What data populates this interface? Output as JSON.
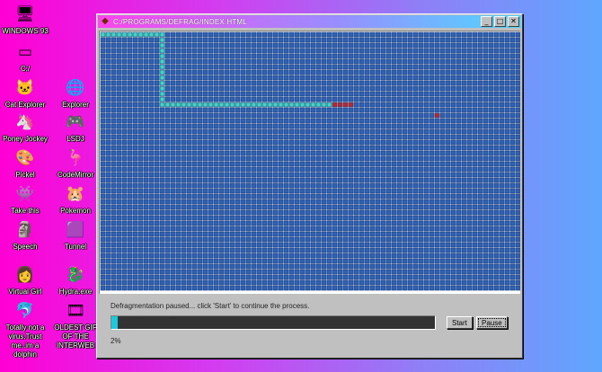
{
  "desktop": {
    "icons": [
      {
        "label": "WINDOWS 93",
        "glyph": "🖥"
      },
      {
        "label": "C:/",
        "glyph": "▭"
      },
      {
        "label": "Cat Explorer",
        "glyph": "🐱"
      },
      {
        "label": "Explorer",
        "glyph": "🌐"
      },
      {
        "label": "Poney Jockey",
        "glyph": "🦄"
      },
      {
        "label": "LSDJ",
        "glyph": "🎮"
      },
      {
        "label": "Pickel",
        "glyph": "🎨"
      },
      {
        "label": "CodeMirror",
        "glyph": "🦩"
      },
      {
        "label": "Take this",
        "glyph": "👾"
      },
      {
        "label": "Pokemon",
        "glyph": "🐹"
      },
      {
        "label": "Speech",
        "glyph": "🗿"
      },
      {
        "label": "Tunnel",
        "glyph": "🟪"
      },
      {
        "label": "Virtual Girl",
        "glyph": "👩"
      },
      {
        "label": "Hydra.exe",
        "glyph": "🐉"
      },
      {
        "label": "Totally not a\nvirus.Trust\nme..im a\ndolphin",
        "glyph": "🐬"
      },
      {
        "label": "OLDEST GIF\nOF THE\nINTERWEB",
        "glyph": "🎞"
      }
    ]
  },
  "window": {
    "title": "C:/PROGRAMS/DEFRAG/INDEX.HTML",
    "app_icon": "defrag-app-icon",
    "controls": {
      "minimize": "_",
      "maximize": "□",
      "close": "✕"
    },
    "status_text": "Defragmentation paused... click 'Start' to continue the process.",
    "progress": {
      "percent_label": "2%",
      "fraction": 0.02
    },
    "buttons": {
      "start": "Start",
      "pause": "Pause"
    }
  },
  "colors": {
    "block_default": "#2e62b6",
    "block_done": "#3fd7c3",
    "block_active": "#c0262b",
    "progress_fill": "#1ec8dc"
  }
}
